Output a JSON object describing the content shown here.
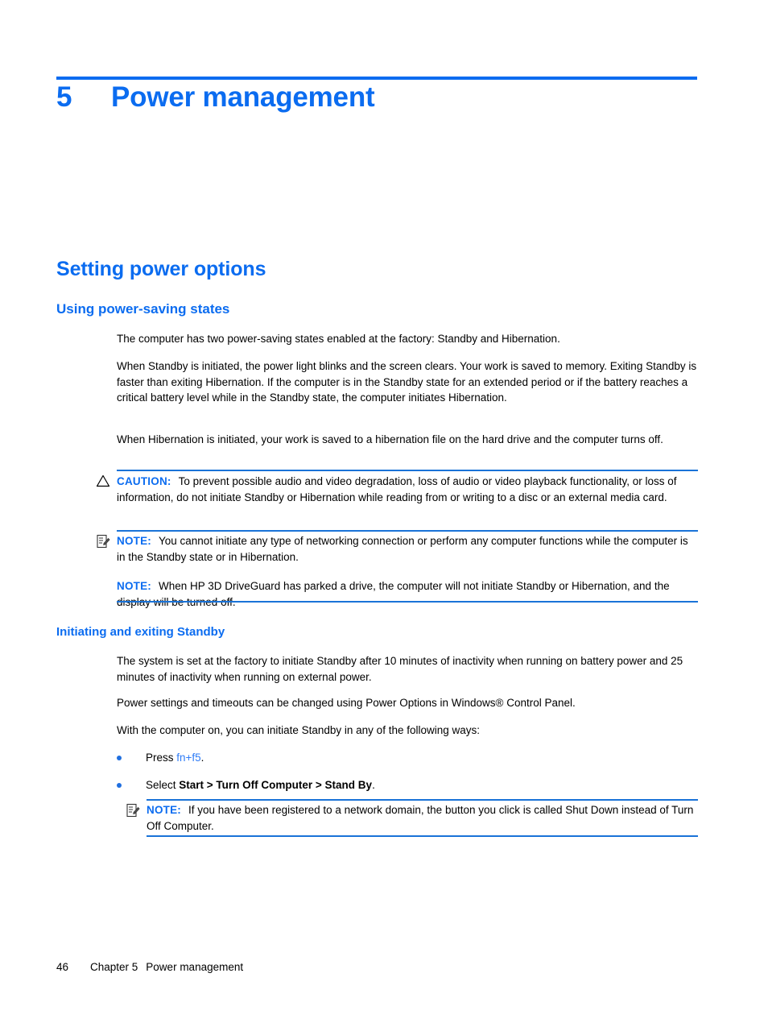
{
  "document": {
    "chapter_number": "5",
    "chapter_title": "Power management"
  },
  "sections": {
    "h1": "Setting power options",
    "h2_power_saving": "Using power-saving states",
    "h3_standby": "Initiating and exiting Standby"
  },
  "paragraphs": {
    "p1": "The computer has two power-saving states enabled at the factory: Standby and Hibernation.",
    "p2": "When Standby is initiated, the power light blinks and the screen clears. Your work is saved to memory. Exiting Standby is faster than exiting Hibernation. If the computer is in the Standby state for an extended period or if the battery reaches a critical battery level while in the Standby state, the computer initiates Hibernation.",
    "p3": "When Hibernation is initiated, your work is saved to a hibernation file on the hard drive and the computer turns off.",
    "p4": "The system is set at the factory to initiate Standby after 10 minutes of inactivity when running on battery power and 25 minutes of inactivity when running on external power.",
    "p5": "Power settings and timeouts can be changed using Power Options in Windows® Control Panel.",
    "p6": "With the computer on, you can initiate Standby in any of the following ways:"
  },
  "admonitions": {
    "caution1": {
      "label": "CAUTION:",
      "icon": "warning-triangle-icon",
      "text": "To prevent possible audio and video degradation, loss of audio or video playback functionality, or loss of information, do not initiate Standby or Hibernation while reading from or writing to a disc or an external media card."
    },
    "note1": {
      "label": "NOTE:",
      "icon": "note-clipboard-icon",
      "text": "You cannot initiate any type of networking connection or perform any computer functions while the computer is in the Standby state or in Hibernation."
    },
    "note2": {
      "label": "NOTE:",
      "text": "When HP 3D DriveGuard has parked a drive, the computer will not initiate Standby or Hibernation, and the display will be turned off."
    },
    "note3": {
      "label": "NOTE:",
      "icon": "note-clipboard-icon",
      "text": "If you have been registered to a network domain, the button you click is called Shut Down instead of Turn Off Computer."
    }
  },
  "bullets": {
    "item1": {
      "prefix": "Press ",
      "link": "fn+f5",
      "suffix": "."
    },
    "item2": {
      "prefix": "Select ",
      "bold": "Start > Turn Off Computer > Stand By",
      "suffix": "."
    }
  },
  "footer": {
    "page_number": "46",
    "chapter_label": "Chapter 5",
    "chapter_title": "Power management"
  },
  "colors": {
    "accent_blue": "#0b6cf0",
    "rule_blue": "#1a73d8",
    "link_blue": "#2f7cf6"
  }
}
